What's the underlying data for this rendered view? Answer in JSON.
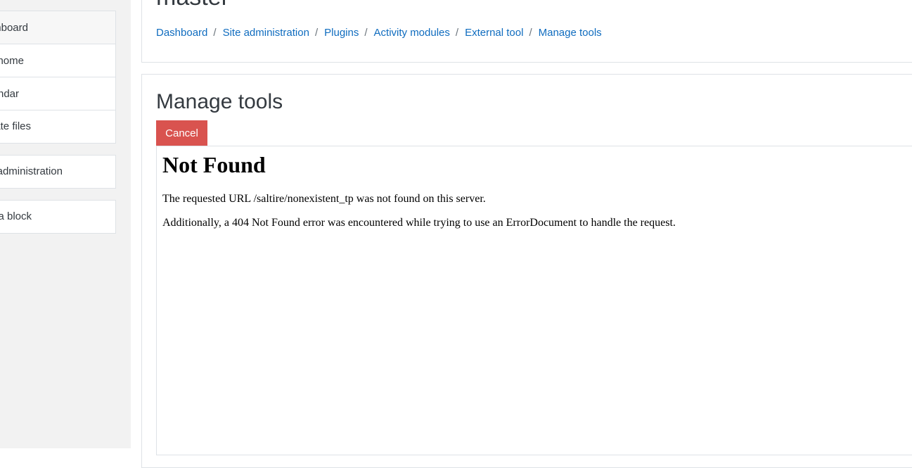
{
  "site": {
    "title": "master"
  },
  "nav": {
    "group1": [
      {
        "label": "Dashboard",
        "active": true
      },
      {
        "label": "Site home",
        "active": false
      },
      {
        "label": "Calendar",
        "active": false
      },
      {
        "label": "Private files",
        "active": false
      }
    ],
    "group2": [
      {
        "label": "Site administration"
      }
    ],
    "group3": [
      {
        "label": "Add a block"
      }
    ]
  },
  "breadcrumb": {
    "items": [
      "Dashboard",
      "Site administration",
      "Plugins",
      "Activity modules",
      "External tool",
      "Manage tools"
    ],
    "separator": "/"
  },
  "page": {
    "title": "Manage tools",
    "cancel_label": "Cancel"
  },
  "error": {
    "title": "Not Found",
    "line1": "The requested URL /saltire/nonexistent_tp was not found on this server.",
    "line2": "Additionally, a 404 Not Found error was encountered while trying to use an ErrorDocument to handle the request."
  },
  "colors": {
    "link": "#0f6cbf",
    "danger": "#d9534f",
    "drawer_bg": "#f2f2f2"
  }
}
